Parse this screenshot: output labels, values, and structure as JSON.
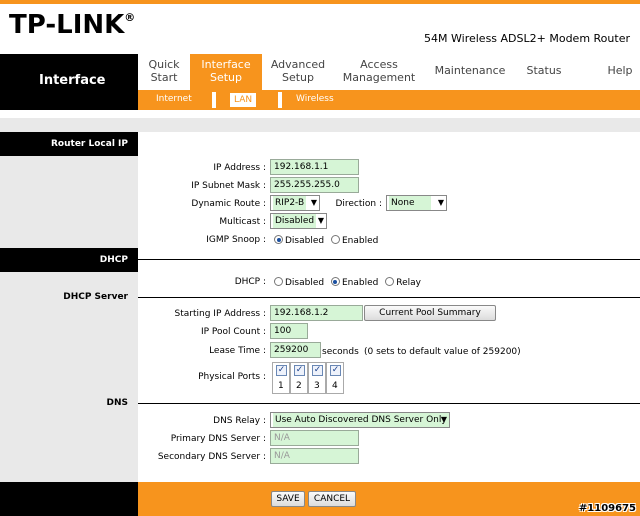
{
  "header": {
    "brand": "TP-LINK",
    "brand_mark": "®",
    "model": "54M Wireless ADSL2+ Modem Router"
  },
  "nav": {
    "section": "Interface",
    "tabs": [
      {
        "line1": "Quick",
        "line2": "Start"
      },
      {
        "line1": "Interface",
        "line2": "Setup"
      },
      {
        "line1": "Advanced",
        "line2": "Setup"
      },
      {
        "line1": "Access",
        "line2": "Management"
      },
      {
        "line1": "Maintenance",
        "line2": ""
      },
      {
        "line1": "Status",
        "line2": ""
      },
      {
        "line1": "Help",
        "line2": ""
      }
    ],
    "subtabs": [
      "Internet",
      "LAN",
      "Wireless"
    ]
  },
  "router_ip": {
    "heading": "Router Local IP",
    "ip_label": "IP Address :",
    "ip_value": "192.168.1.1",
    "mask_label": "IP Subnet Mask :",
    "mask_value": "255.255.255.0",
    "route_label": "Dynamic Route :",
    "route_value": "RIP2-B",
    "direction_label": "Direction :",
    "direction_value": "None",
    "multicast_label": "Multicast :",
    "multicast_value": "Disabled",
    "igmp_label": "IGMP Snoop :",
    "igmp_opt1": "Disabled",
    "igmp_opt2": "Enabled"
  },
  "dhcp": {
    "heading": "DHCP",
    "server_label": "DHCP Server",
    "dhcp_label": "DHCP :",
    "opt_disabled": "Disabled",
    "opt_enabled": "Enabled",
    "opt_relay": "Relay",
    "start_label": "Starting IP Address :",
    "start_value": "192.168.1.2",
    "pool_button": "Current Pool Summary",
    "count_label": "IP Pool Count :",
    "count_value": "100",
    "lease_label": "Lease Time :",
    "lease_value": "259200",
    "lease_unit": "seconds",
    "lease_note": "(0 sets to default value of 259200)",
    "ports_label": "Physical Ports :",
    "ports": [
      "1",
      "2",
      "3",
      "4"
    ]
  },
  "dns": {
    "heading": "DNS",
    "relay_label": "DNS Relay :",
    "relay_value": "Use Auto Discovered DNS Server Only",
    "primary_label": "Primary DNS Server :",
    "primary_value": "N/A",
    "secondary_label": "Secondary DNS Server :",
    "secondary_value": "N/A"
  },
  "footer": {
    "save": "SAVE",
    "cancel": "CANCEL"
  },
  "watermark": "#1109675",
  "colors": {
    "accent": "#f7941d",
    "field": "#d6f5d6",
    "dark": "#000000"
  }
}
